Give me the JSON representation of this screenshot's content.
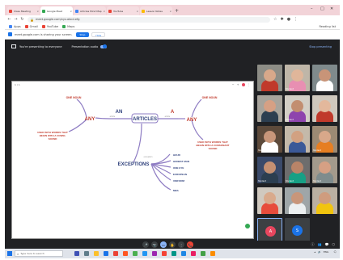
{
  "browser": {
    "tabs": [
      {
        "label": "Class Meeting",
        "color": "#ea4335",
        "active": false
      },
      {
        "label": "Google Meet",
        "color": "#34a853",
        "active": true
      },
      {
        "label": "Articles Mind Map",
        "color": "#4285f4",
        "active": false
      },
      {
        "label": "YouTube",
        "color": "#ea4335",
        "active": false
      },
      {
        "label": "Lesson Notes",
        "color": "#fbbc04",
        "active": false
      }
    ],
    "new_tab_label": "+",
    "url": "meet.google.com/xyz-abcd-efg",
    "bookmarks": [
      {
        "label": "Apps",
        "color": "#4285f4"
      },
      {
        "label": "Gmail",
        "color": "#ea4335"
      },
      {
        "label": "YouTube",
        "color": "#ea4335"
      },
      {
        "label": "Maps",
        "color": "#34a853"
      }
    ],
    "bookmarks_right": "Reading list"
  },
  "infobar": {
    "message": "meet.google.com is sharing your screen.",
    "stop_label": "Stop",
    "hide_label": "Hide"
  },
  "meet_top": {
    "presenting_label": "You're presenting to everyone",
    "pause_label": "Presentation audio",
    "stop_label": "Stop presenting"
  },
  "presentation": {
    "page_label": "1 / 1"
  },
  "mindmap": {
    "center": "ARTICLES",
    "an": "AN",
    "a": "A",
    "an_any": "ANY",
    "a_any": "ANY",
    "an_one": "ONE NOUN",
    "a_one": "ONE NOUN",
    "an_rule": [
      "USED WITH WORDS THAT",
      "BEGIN WITH A VOWEL",
      "SOUND"
    ],
    "a_rule": [
      "USED WITH WORDS THAT",
      "BEGIN WITH A CONSONANT",
      "SOUND"
    ],
    "exceptions": "EXCEPTIONS",
    "exception_items": [
      "HOUR",
      "HONEST MAN",
      "ONE EYE",
      "EUROPEAN",
      "UNIFORM",
      "MBA"
    ],
    "link_label_left": "article",
    "link_label_right": "article",
    "link_label_exc": "exception"
  },
  "participants": [
    {
      "name": "",
      "skin": "#d8a88a",
      "shirt": "#c0392b",
      "bg": "#8d8d86"
    },
    {
      "name": "Student",
      "skin": "#e0b69a",
      "shirt": "#e88fb2",
      "bg": "#bfb6a8"
    },
    {
      "name": "",
      "skin": "#c89478",
      "shirt": "#ffffff",
      "bg": "#7f8a8c"
    },
    {
      "name": "",
      "skin": "#d6a084",
      "shirt": "#2c3e50",
      "bg": "#a8a49c"
    },
    {
      "name": "Student",
      "skin": "#c28e70",
      "shirt": "#8e44ad",
      "bg": "#d3cfc6"
    },
    {
      "name": "",
      "skin": "#e3b89c",
      "shirt": "#c0392b",
      "bg": "#cfc8bd"
    },
    {
      "name": "Student",
      "skin": "#c8967a",
      "shirt": "#ffffff",
      "bg": "#5d4a3b"
    },
    {
      "name": "",
      "skin": "#d2a182",
      "shirt": "#3b5998",
      "bg": "#c4b9aa"
    },
    {
      "name": "Student",
      "skin": "#d8a88a",
      "shirt": "#e67e22",
      "bg": "#9c8a74"
    },
    {
      "name": "Student",
      "skin": "#c59072",
      "shirt": "#2c3e50",
      "bg": "#3a4a6a"
    },
    {
      "name": "Student",
      "skin": "#b88468",
      "shirt": "#16a085",
      "bg": "#6d6d6d"
    },
    {
      "name": "Student",
      "skin": "#d6a084",
      "shirt": "#7f8c8d",
      "bg": "#a39a8c"
    },
    {
      "name": "",
      "skin": "#d9aa8c",
      "shirt": "#e74c3c",
      "bg": "#d0c9bf"
    },
    {
      "name": "",
      "skin": "#c8967a",
      "shirt": "#ecf0f1",
      "bg": "#9fa6a8"
    },
    {
      "name": "",
      "skin": "#cf9c7e",
      "shirt": "#f1c40f",
      "bg": "#bab0a2"
    }
  ],
  "self_tile": {
    "name": "",
    "initial": "A",
    "color": "#e8465e"
  },
  "other_avatar": {
    "name": "",
    "initial": "S",
    "color": "#1a73e8"
  },
  "controls": {
    "meeting_info": "",
    "buttons": [
      "🎤",
      "📷",
      "▭",
      "✋",
      "⋮",
      "📞"
    ]
  },
  "taskbar": {
    "search_placeholder": "Type here to search",
    "apps": [
      "#3f51b5",
      "#607d8b",
      "#fbc02d",
      "#1a73e8",
      "#ea4335",
      "#ff5722",
      "#4caf50",
      "#2196f3",
      "#9c27b0",
      "#f44336",
      "#009688",
      "#1e88e5",
      "#e91e63",
      "#43a047",
      "#fb8c00"
    ],
    "tray_text": "ENG",
    "clock": ""
  }
}
